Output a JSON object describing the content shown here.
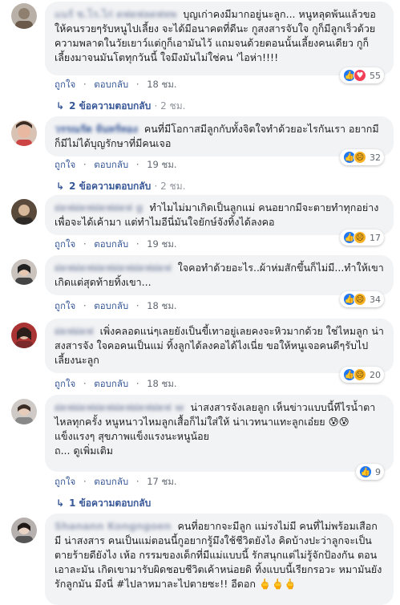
{
  "comments": [
    {
      "name": "แนร์ ช.โร.ไก่ ดฟดฟลดฟหพ",
      "text": "บุญเก่าคงมีมากอยู่นะลูก... หนูหลุดพ้นแล้วขอให้คนรวยๆรับหนูไปเลี้ยง จะได้มีอนาคตที่ดีนะ กูสงสารจับใจ กูก็มีลูกเร็วด้วยความพลาดในวัยเยาว์แต่กูก็เอามันไว้ แถมจนด้วยตอนนั้นเลี้ยงคนเดียว กูก็เลี้ยงมาจนมันโตทุกวันนี้ ใจมึงมันไม่ใช่คน 'ไอห่า!!!!",
      "like": "ถูกใจ",
      "reply": "ตอบกลับ",
      "dot": "·",
      "time": "18 ชม.",
      "reactions": [
        "like",
        "love"
      ],
      "reaction_count": "55",
      "replies": "2 ข้อความตอบกลับ",
      "replies_age": "· 2 ชม."
    },
    {
      "name": "วรรณรัต จันทร์ทอง",
      "text": "คนที่มีโอกาสมีลูกกับทั้งจิตใจทำด้วยอะไรกันเรา อยากมีก็มีไม่ได้บุญรักษาที่มีคนเจอ",
      "like": "ถูกใจ",
      "reply": "ตอบกลับ",
      "dot": "·",
      "time": "19 ชม.",
      "reactions": [
        "like",
        "sad"
      ],
      "reaction_count": "32",
      "replies": "2 ข้อความตอบกลับ",
      "replies_age": "· 2 ชม."
    },
    {
      "name": "ฝดฟฝดฟฝดฟฝดฟ g",
      "text": "ทำไมไม่มาเกิดเป็นลูกแม่ คนอยากมีจะตายทำทุกอย่างเพื่อจะได้เค้ามา แต่ทำไมอีนี่มันใจยักษ์จังทิ้งได้ลงคอ",
      "like": "ถูกใจ",
      "reply": "ตอบกลับ",
      "dot": "·",
      "time": "19 ชม.",
      "reactions": [
        "like",
        "sad"
      ],
      "reaction_count": "17"
    },
    {
      "name": "ฝดฟฝดฟฝดฟฝดฟฝดฟฝดฟ",
      "text": "ใจคอทำด้วยอะไร..ผ้าห่มสักขึ้นก็ไม่มี...ทำให้เขาเกิดแต่สุดท้ายทิ้งเขา...",
      "like": "ถูกใจ",
      "reply": "ตอบกลับ",
      "dot": "·",
      "time": "18 ชม.",
      "reactions": [
        "like",
        "sad"
      ],
      "reaction_count": "34"
    },
    {
      "name": "ฝดฟฝดฟ",
      "text": "เพิ่งคลอดแน่ๆเลยยังเป็นขี้เทาอยู่เลยคงจะหิวมากด้วย ใช่ไหมลูก น่าสงสารจัง ใจคอคนเป็นแม่ ทิ้งลูกได้ลงคอได้ไงเนี่ย ขอให้หนูเจอคนดีๆรับไปเลี้ยงนะลูก",
      "like": "ถูกใจ",
      "reply": "ตอบกลับ",
      "dot": "·",
      "time": "18 ชม.",
      "reactions": [
        "like",
        "sad"
      ],
      "reaction_count": "20"
    },
    {
      "name": "ฝดฟฝดฟฝดฟฝดฟฝดฟฝดฟ w",
      "text": "น่าสงสารจังเลยลูก เห็นข่าวแบบนี้ทีไรน้ำตาไหลทุกครั้ง หนูหนาวไหมลูกเสื้อก็ไม่ใส่ให้ น่าเวทนาแทะลูกเอ๋ยย 😰😰\nแข็งแรงๆ สุขภาพแข็งแรงนะหนูน้อย\nถ... ดูเพิ่มเติม",
      "like": "ถูกใจ",
      "reply": "ตอบกลับ",
      "dot": "·",
      "time": "17 ชม.",
      "reactions": [
        "like"
      ],
      "reaction_count": "9",
      "replies": "1 ข้อความตอบกลับ"
    },
    {
      "name": "Shanann Kongngoen",
      "text": "คนที่อยากจะมีลูก แม่รงไม่มี คนที่ไม่พร้อมเสือกมี น่าสงสาร คนเป็นแม่ตอนนี้กูอยากรู้มึงใช้ชีวิตยังไง คิดบ้างปะว่าลูกจะเป็นตายร้ายดียังไง เห้อ กรรมของเด็กที่มีแม่แบบนี้ รักสนุกแต่ไม่รู้จักป้องกัน ตอนเอาละมัน เกิดเขามารับผิดชอบชีวิตเค้าหน่อยดิ ทิ้งแบบนี้เรียกรอวะ หมามันยังรักลูกมัน มึงนี่ #ไปลาหมาละไปตายซะ!! อีดอก 🖕🖕🖕"
    }
  ]
}
